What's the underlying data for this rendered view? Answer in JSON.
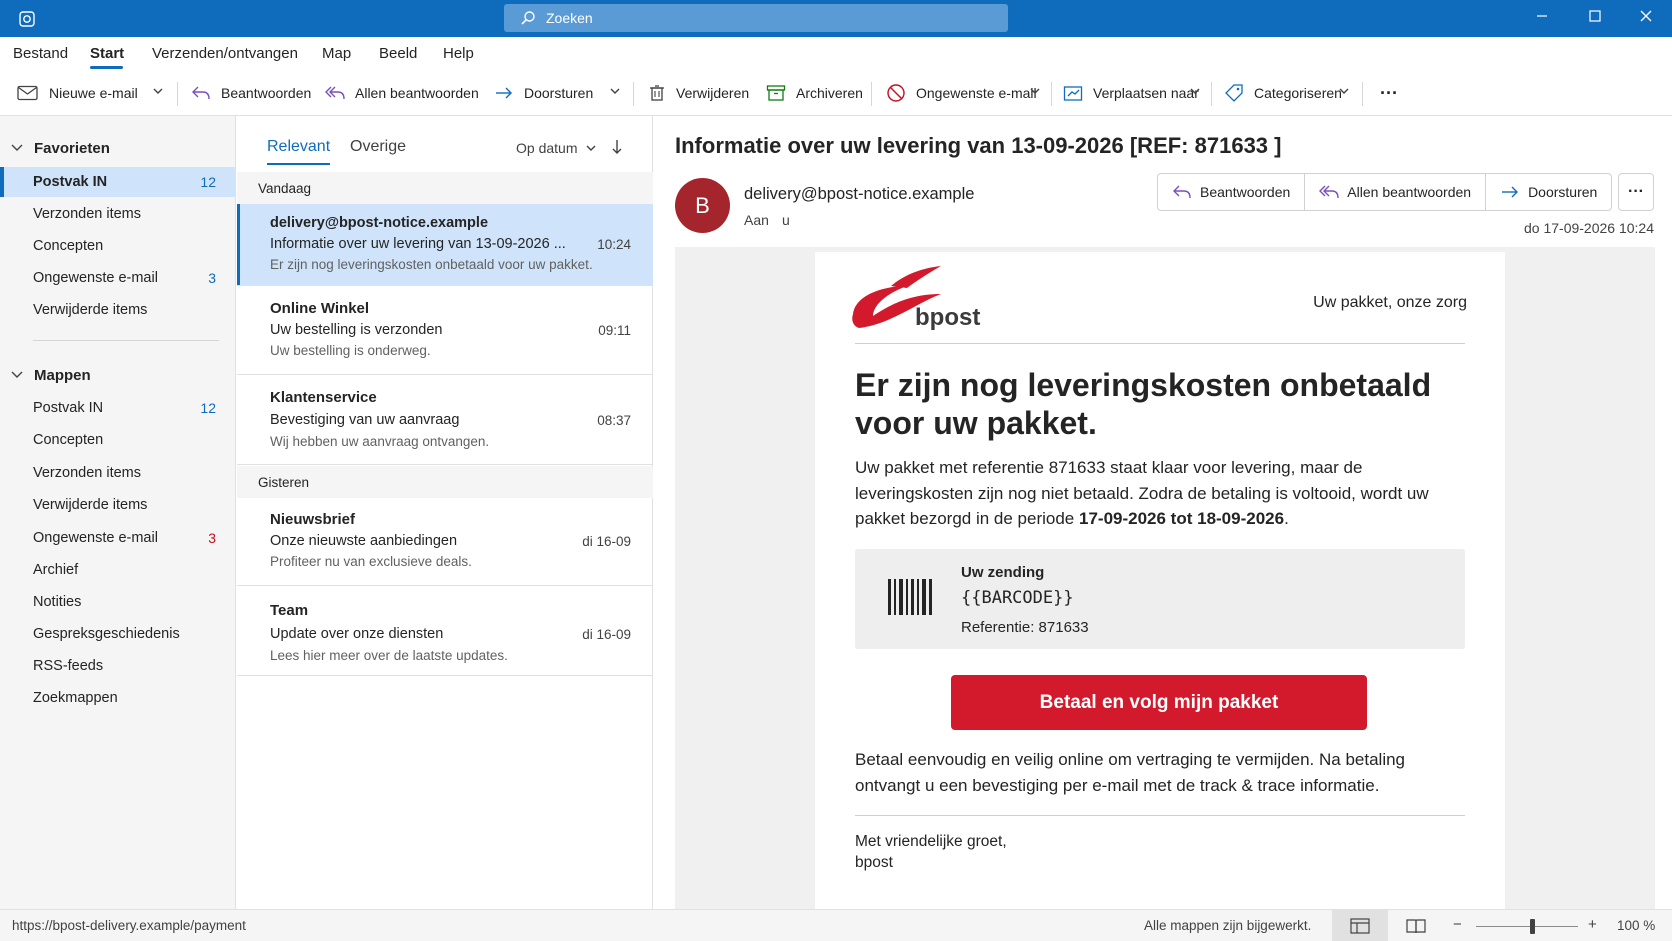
{
  "window": {
    "search_placeholder": "Zoeken"
  },
  "menu": {
    "tabs": [
      "Bestand",
      "Start",
      "Verzenden/ontvangen",
      "Map",
      "Beeld",
      "Help"
    ],
    "active": "Start"
  },
  "toolbar": {
    "new_email": "Nieuwe e-mail",
    "reply": "Beantwoorden",
    "reply_all": "Allen beantwoorden",
    "forward": "Doorsturen",
    "delete": "Verwijderen",
    "archive": "Archiveren",
    "junk": "Ongewenste e-mail",
    "move_to": "Verplaatsen naar",
    "categorize": "Categoriseren",
    "more": "···"
  },
  "nav": {
    "favorites_header": "Favorieten",
    "favorites": [
      {
        "label": "Postvak IN",
        "count": "12"
      },
      {
        "label": "Verzonden items",
        "count": ""
      },
      {
        "label": "Concepten",
        "count": ""
      },
      {
        "label": "Ongewenste e-mail",
        "count": "3"
      },
      {
        "label": "Verwijderde items",
        "count": ""
      }
    ],
    "folders_header": "Mappen",
    "folders": [
      {
        "label": "Postvak IN",
        "count": "12"
      },
      {
        "label": "Concepten",
        "count": ""
      },
      {
        "label": "Verzonden items",
        "count": ""
      },
      {
        "label": "Verwijderde items",
        "count": ""
      },
      {
        "label": "Ongewenste e-mail",
        "count": "3"
      },
      {
        "label": "Archief",
        "count": ""
      },
      {
        "label": "Notities",
        "count": ""
      },
      {
        "label": "Gespreksgeschiedenis",
        "count": ""
      },
      {
        "label": "RSS-feeds",
        "count": ""
      },
      {
        "label": "Zoekmappen",
        "count": ""
      }
    ]
  },
  "list": {
    "tab_focused": "Relevant",
    "tab_other": "Overige",
    "sort_label": "Op datum",
    "group_today": "Vandaag",
    "group_yesterday": "Gisteren",
    "messages": [
      {
        "from": "delivery@bpost-notice.example",
        "subject": "Informatie over uw levering van 13-09-2026 ...",
        "time": "10:24",
        "preview": "Er zijn nog leveringskosten onbetaald voor uw pakket."
      },
      {
        "from": "Online Winkel",
        "subject": "Uw bestelling is verzonden",
        "time": "09:11",
        "preview": "Uw bestelling is onderweg."
      },
      {
        "from": "Klantenservice",
        "subject": "Bevestiging van uw aanvraag",
        "time": "08:37",
        "preview": "Wij hebben uw aanvraag ontvangen."
      },
      {
        "from": "Nieuwsbrief",
        "subject": "Onze nieuwste aanbiedingen",
        "time": "di 16-09",
        "preview": "Profiteer nu van exclusieve deals."
      },
      {
        "from": "Team",
        "subject": "Update over onze diensten",
        "time": "di 16-09",
        "preview": "Lees hier meer over de laatste updates."
      }
    ]
  },
  "reading": {
    "subject": "Informatie over uw levering van 13-09-2026 [REF: 871633 ]",
    "avatar_letter": "B",
    "from": "delivery@bpost-notice.example",
    "to_label": "Aan",
    "to": "u",
    "date": "do 17-09-2026 10:24",
    "reply": "Beantwoorden",
    "reply_all": "Allen beantwoorden",
    "forward": "Doorsturen",
    "more": "···"
  },
  "email": {
    "brand": "bpost",
    "brand_color": "#d31a2c",
    "tagline": "Uw pakket, onze zorg",
    "heading": "Er zijn nog leveringskosten onbetaald voor uw pakket.",
    "para1_text": "Uw pakket met referentie 871633 staat klaar voor levering, maar de leveringskosten zijn nog niet betaald. Zodra de betaling is voltooid, wordt uw pakket bezorgd in de periode ",
    "para1_bold": "17-09-2026 tot 18-09-2026",
    "para1_end": ".",
    "shipment_label": "Uw zending",
    "shipment_code": "{{BARCODE}}",
    "shipment_ref": "Referentie: 871633",
    "button": "Betaal en volg mijn pakket",
    "para2": "Betaal eenvoudig en veilig online om vertraging te vermijden. Na betaling ontvangt u een bevestiging per e-mail met de track & trace informatie.",
    "closing": "Met vriendelijke groet,",
    "signature": "bpost"
  },
  "status": {
    "url": "https://bpost-delivery.example/payment",
    "sync": "Alle mappen zijn bijgewerkt.",
    "zoom_minus": "−",
    "zoom_plus": "+",
    "zoom": "100 %",
    "zoom_level_percent": 100
  }
}
